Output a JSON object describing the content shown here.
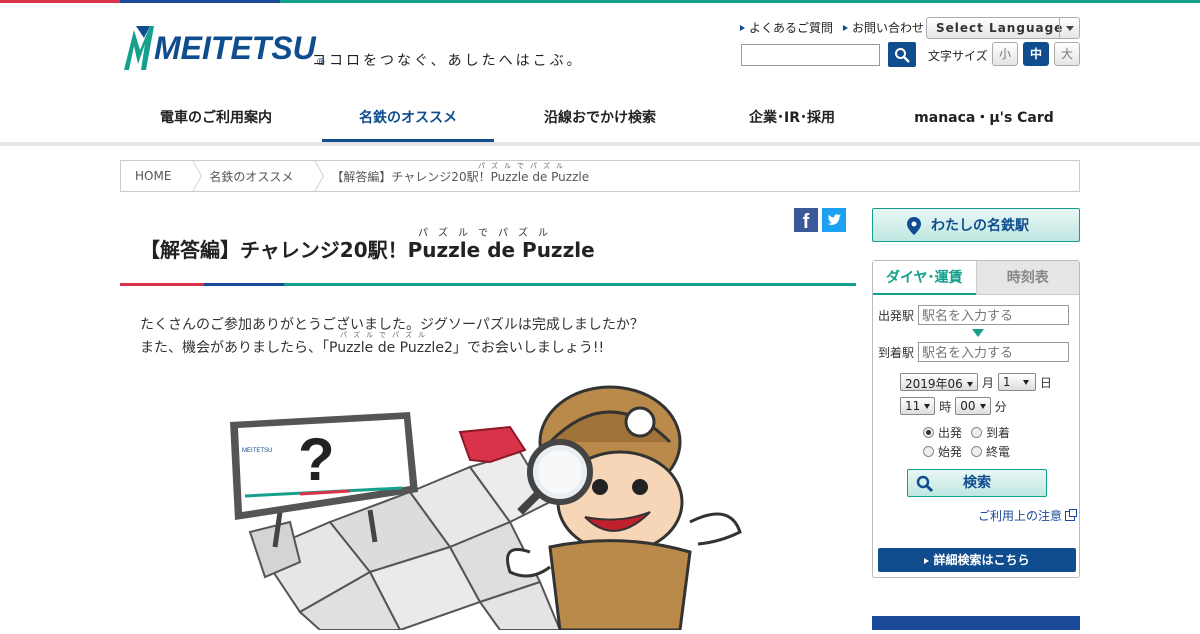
{
  "brand": {
    "logo_text": "MEITETSU",
    "logo_registered": "®",
    "tagline": "ココロをつなぐ、あしたへはこぶ。",
    "colors": {
      "blue": "#0f4d8f",
      "red": "#d8334a",
      "teal": "#14a08d"
    }
  },
  "utility": {
    "faq": "よくあるご質問",
    "contact": "お問い合わせ",
    "language": "Select Language",
    "search_placeholder": "",
    "font_size_label": "文字サイズ",
    "font_sizes": [
      "小",
      "中",
      "大"
    ],
    "font_size_selected": "中"
  },
  "gnav": {
    "items": [
      "電車のご利用案内",
      "名鉄のオススメ",
      "沿線おでかけ検索",
      "企業･IR･採用",
      "manaca・μ's Card"
    ],
    "active": "名鉄のオススメ"
  },
  "breadcrumb": {
    "items": [
      "HOME",
      "名鉄のオススメ",
      "【解答編】チャレンジ20駅！Puzzle de Puzzle"
    ],
    "ruby": "パズルでパズル"
  },
  "article": {
    "title": "【解答編】チャレンジ20駅！Puzzle de Puzzle",
    "title_ruby": "パズルでパズル",
    "body_line1": "たくさんのご参加ありがとうございました。ジグソーパズルは完成しましたか？",
    "body_line2": "また、機会がありましたら、「Puzzle de Puzzle2」でお会いしましょう!!",
    "body_ruby": "パズルでパズル",
    "sign_text": "?",
    "sign_logo": "MEITETSU",
    "share_facebook": "f"
  },
  "sidebar": {
    "my_meitetsu": "わたしの名鉄駅",
    "tabs": [
      "ダイヤ･運賃",
      "時刻表"
    ],
    "active_tab": "ダイヤ･運賃",
    "from_label": "出発駅",
    "to_label": "到着駅",
    "station_placeholder": "駅名を入力する",
    "year_month": "2019年06",
    "month_unit": "月",
    "day": "1",
    "day_unit": "日",
    "hour": "11",
    "hour_unit": "時",
    "minute": "00",
    "minute_unit": "分",
    "radios": [
      {
        "label": "出発",
        "checked": true
      },
      {
        "label": "到着",
        "checked": false
      },
      {
        "label": "始発",
        "checked": false
      },
      {
        "label": "終電",
        "checked": false
      }
    ],
    "search_button": "検索",
    "notice_link": "ご利用上の注意",
    "detail_search": "詳細検索はこちら"
  }
}
